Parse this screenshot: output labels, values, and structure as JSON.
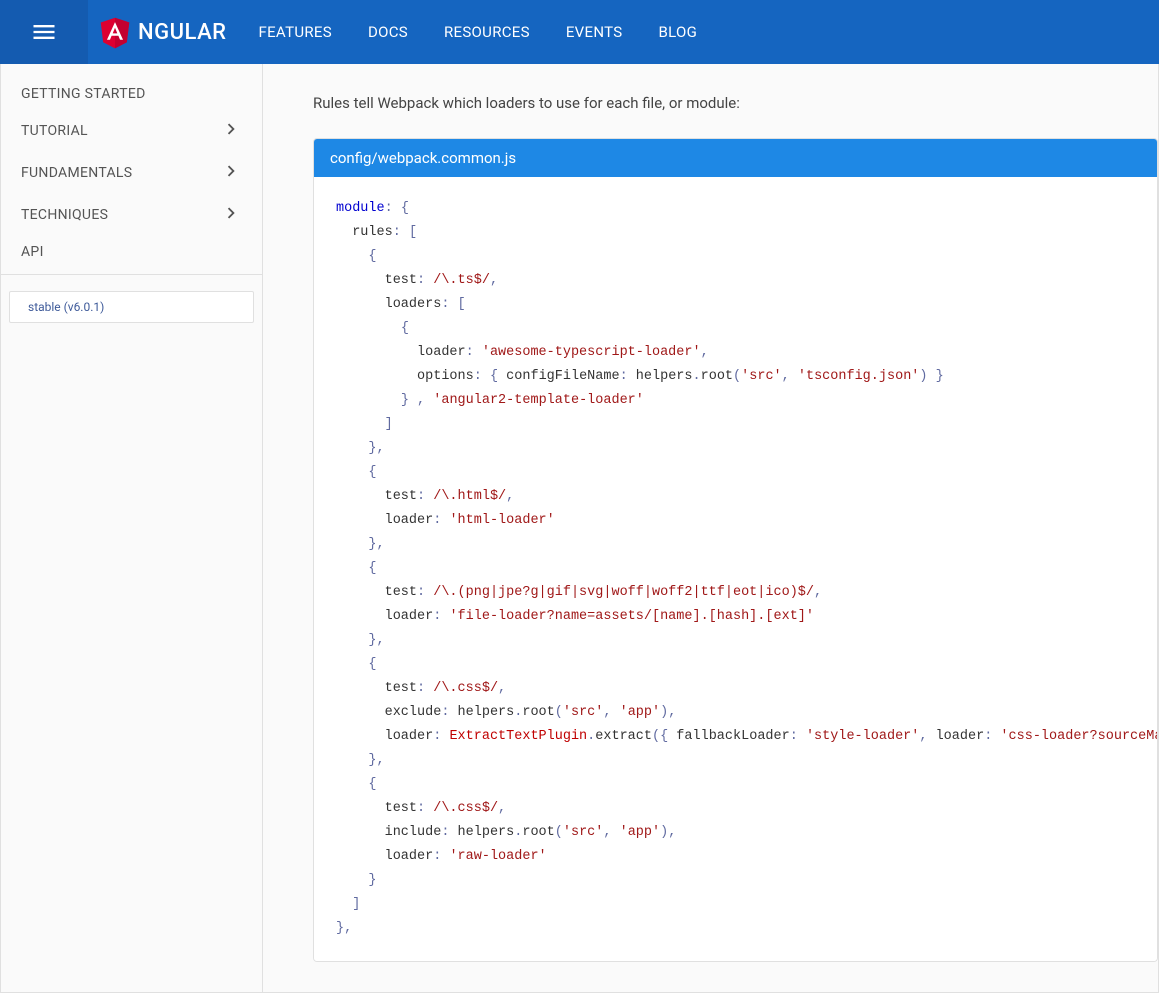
{
  "brand": "NGULAR",
  "nav": [
    "FEATURES",
    "DOCS",
    "RESOURCES",
    "EVENTS",
    "BLOG"
  ],
  "sidebar": {
    "items": [
      {
        "label": "GETTING STARTED",
        "expandable": false
      },
      {
        "label": "TUTORIAL",
        "expandable": true
      },
      {
        "label": "FUNDAMENTALS",
        "expandable": true
      },
      {
        "label": "TECHNIQUES",
        "expandable": true
      },
      {
        "label": "API",
        "expandable": false
      }
    ],
    "version": "stable (v6.0.1)"
  },
  "intro": "Rules tell Webpack which loaders to use for each file, or module:",
  "code": {
    "filename": "config/webpack.common.js",
    "tokens": [
      {
        "t": "kw",
        "v": "module"
      },
      {
        "t": "pn",
        "v": ":"
      },
      {
        "t": "",
        "v": " "
      },
      {
        "t": "pn",
        "v": "{"
      },
      {
        "t": "nl"
      },
      {
        "t": "",
        "v": "  rules"
      },
      {
        "t": "pn",
        "v": ":"
      },
      {
        "t": "",
        "v": " "
      },
      {
        "t": "pn",
        "v": "["
      },
      {
        "t": "nl"
      },
      {
        "t": "",
        "v": "    "
      },
      {
        "t": "pn",
        "v": "{"
      },
      {
        "t": "nl"
      },
      {
        "t": "",
        "v": "      test"
      },
      {
        "t": "pn",
        "v": ":"
      },
      {
        "t": "",
        "v": " "
      },
      {
        "t": "rx",
        "v": "/\\.ts$/"
      },
      {
        "t": "pn",
        "v": ","
      },
      {
        "t": "nl"
      },
      {
        "t": "",
        "v": "      loaders"
      },
      {
        "t": "pn",
        "v": ":"
      },
      {
        "t": "",
        "v": " "
      },
      {
        "t": "pn",
        "v": "["
      },
      {
        "t": "nl"
      },
      {
        "t": "",
        "v": "        "
      },
      {
        "t": "pn",
        "v": "{"
      },
      {
        "t": "nl"
      },
      {
        "t": "",
        "v": "          loader"
      },
      {
        "t": "pn",
        "v": ":"
      },
      {
        "t": "",
        "v": " "
      },
      {
        "t": "str",
        "v": "'awesome-typescript-loader'"
      },
      {
        "t": "pn",
        "v": ","
      },
      {
        "t": "nl"
      },
      {
        "t": "",
        "v": "          options"
      },
      {
        "t": "pn",
        "v": ":"
      },
      {
        "t": "",
        "v": " "
      },
      {
        "t": "pn",
        "v": "{"
      },
      {
        "t": "",
        "v": " configFileName"
      },
      {
        "t": "pn",
        "v": ":"
      },
      {
        "t": "",
        "v": " helpers"
      },
      {
        "t": "pn",
        "v": "."
      },
      {
        "t": "",
        "v": "root"
      },
      {
        "t": "pn",
        "v": "("
      },
      {
        "t": "str",
        "v": "'src'"
      },
      {
        "t": "pn",
        "v": ","
      },
      {
        "t": "",
        "v": " "
      },
      {
        "t": "str",
        "v": "'tsconfig.json'"
      },
      {
        "t": "pn",
        "v": ")"
      },
      {
        "t": "",
        "v": " "
      },
      {
        "t": "pn",
        "v": "}"
      },
      {
        "t": "nl"
      },
      {
        "t": "",
        "v": "        "
      },
      {
        "t": "pn",
        "v": "}"
      },
      {
        "t": "",
        "v": " "
      },
      {
        "t": "pn",
        "v": ","
      },
      {
        "t": "",
        "v": " "
      },
      {
        "t": "str",
        "v": "'angular2-template-loader'"
      },
      {
        "t": "nl"
      },
      {
        "t": "",
        "v": "      "
      },
      {
        "t": "pn",
        "v": "]"
      },
      {
        "t": "nl"
      },
      {
        "t": "",
        "v": "    "
      },
      {
        "t": "pn",
        "v": "},"
      },
      {
        "t": "nl"
      },
      {
        "t": "",
        "v": "    "
      },
      {
        "t": "pn",
        "v": "{"
      },
      {
        "t": "nl"
      },
      {
        "t": "",
        "v": "      test"
      },
      {
        "t": "pn",
        "v": ":"
      },
      {
        "t": "",
        "v": " "
      },
      {
        "t": "rx",
        "v": "/\\.html$/"
      },
      {
        "t": "pn",
        "v": ","
      },
      {
        "t": "nl"
      },
      {
        "t": "",
        "v": "      loader"
      },
      {
        "t": "pn",
        "v": ":"
      },
      {
        "t": "",
        "v": " "
      },
      {
        "t": "str",
        "v": "'html-loader'"
      },
      {
        "t": "nl"
      },
      {
        "t": "",
        "v": "    "
      },
      {
        "t": "pn",
        "v": "},"
      },
      {
        "t": "nl"
      },
      {
        "t": "",
        "v": "    "
      },
      {
        "t": "pn",
        "v": "{"
      },
      {
        "t": "nl"
      },
      {
        "t": "",
        "v": "      test"
      },
      {
        "t": "pn",
        "v": ":"
      },
      {
        "t": "",
        "v": " "
      },
      {
        "t": "rx",
        "v": "/\\.(png|jpe?g|gif|svg|woff|woff2|ttf|eot|ico)$/"
      },
      {
        "t": "pn",
        "v": ","
      },
      {
        "t": "nl"
      },
      {
        "t": "",
        "v": "      loader"
      },
      {
        "t": "pn",
        "v": ":"
      },
      {
        "t": "",
        "v": " "
      },
      {
        "t": "str",
        "v": "'file-loader?name=assets/[name].[hash].[ext]'"
      },
      {
        "t": "nl"
      },
      {
        "t": "",
        "v": "    "
      },
      {
        "t": "pn",
        "v": "},"
      },
      {
        "t": "nl"
      },
      {
        "t": "",
        "v": "    "
      },
      {
        "t": "pn",
        "v": "{"
      },
      {
        "t": "nl"
      },
      {
        "t": "",
        "v": "      test"
      },
      {
        "t": "pn",
        "v": ":"
      },
      {
        "t": "",
        "v": " "
      },
      {
        "t": "rx",
        "v": "/\\.css$/"
      },
      {
        "t": "pn",
        "v": ","
      },
      {
        "t": "nl"
      },
      {
        "t": "",
        "v": "      exclude"
      },
      {
        "t": "pn",
        "v": ":"
      },
      {
        "t": "",
        "v": " helpers"
      },
      {
        "t": "pn",
        "v": "."
      },
      {
        "t": "",
        "v": "root"
      },
      {
        "t": "pn",
        "v": "("
      },
      {
        "t": "str",
        "v": "'src'"
      },
      {
        "t": "pn",
        "v": ","
      },
      {
        "t": "",
        "v": " "
      },
      {
        "t": "str",
        "v": "'app'"
      },
      {
        "t": "pn",
        "v": "),"
      },
      {
        "t": "nl"
      },
      {
        "t": "",
        "v": "      loader"
      },
      {
        "t": "pn",
        "v": ":"
      },
      {
        "t": "",
        "v": " "
      },
      {
        "t": "cls",
        "v": "ExtractTextPlugin"
      },
      {
        "t": "pn",
        "v": "."
      },
      {
        "t": "",
        "v": "extract"
      },
      {
        "t": "pn",
        "v": "({"
      },
      {
        "t": "",
        "v": " fallbackLoader"
      },
      {
        "t": "pn",
        "v": ":"
      },
      {
        "t": "",
        "v": " "
      },
      {
        "t": "str",
        "v": "'style-loader'"
      },
      {
        "t": "pn",
        "v": ","
      },
      {
        "t": "",
        "v": " loader"
      },
      {
        "t": "pn",
        "v": ":"
      },
      {
        "t": "",
        "v": " "
      },
      {
        "t": "str",
        "v": "'css-loader?sourceMap'"
      },
      {
        "t": "",
        "v": " "
      },
      {
        "t": "pn",
        "v": "})"
      },
      {
        "t": "nl"
      },
      {
        "t": "",
        "v": "    "
      },
      {
        "t": "pn",
        "v": "},"
      },
      {
        "t": "nl"
      },
      {
        "t": "",
        "v": "    "
      },
      {
        "t": "pn",
        "v": "{"
      },
      {
        "t": "nl"
      },
      {
        "t": "",
        "v": "      test"
      },
      {
        "t": "pn",
        "v": ":"
      },
      {
        "t": "",
        "v": " "
      },
      {
        "t": "rx",
        "v": "/\\.css$/"
      },
      {
        "t": "pn",
        "v": ","
      },
      {
        "t": "nl"
      },
      {
        "t": "",
        "v": "      include"
      },
      {
        "t": "pn",
        "v": ":"
      },
      {
        "t": "",
        "v": " helpers"
      },
      {
        "t": "pn",
        "v": "."
      },
      {
        "t": "",
        "v": "root"
      },
      {
        "t": "pn",
        "v": "("
      },
      {
        "t": "str",
        "v": "'src'"
      },
      {
        "t": "pn",
        "v": ","
      },
      {
        "t": "",
        "v": " "
      },
      {
        "t": "str",
        "v": "'app'"
      },
      {
        "t": "pn",
        "v": "),"
      },
      {
        "t": "nl"
      },
      {
        "t": "",
        "v": "      loader"
      },
      {
        "t": "pn",
        "v": ":"
      },
      {
        "t": "",
        "v": " "
      },
      {
        "t": "str",
        "v": "'raw-loader'"
      },
      {
        "t": "nl"
      },
      {
        "t": "",
        "v": "    "
      },
      {
        "t": "pn",
        "v": "}"
      },
      {
        "t": "nl"
      },
      {
        "t": "",
        "v": "  "
      },
      {
        "t": "pn",
        "v": "]"
      },
      {
        "t": "nl"
      },
      {
        "t": "pn",
        "v": "},"
      }
    ]
  }
}
